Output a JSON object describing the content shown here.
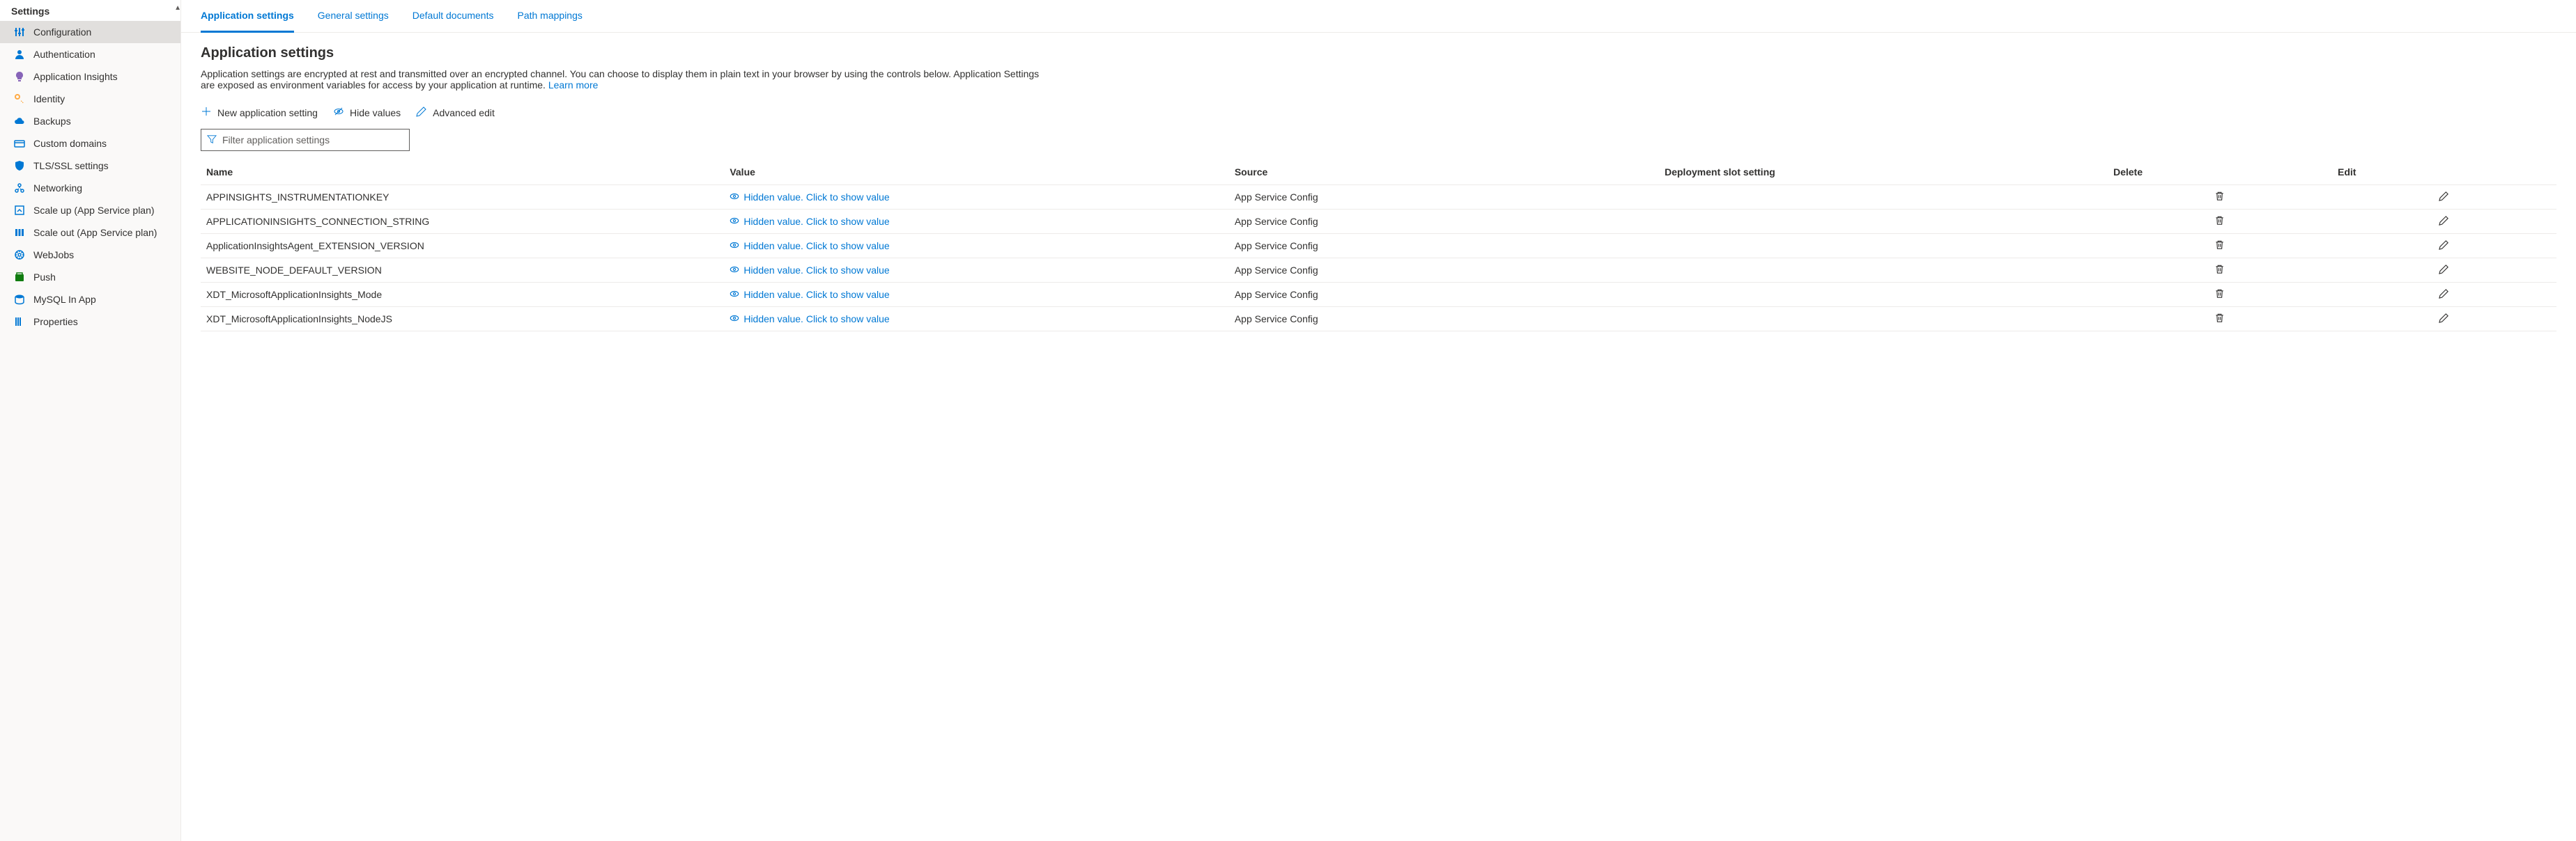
{
  "sidebar": {
    "title": "Settings",
    "items": [
      {
        "icon": "sliders",
        "label": "Configuration",
        "active": true,
        "color": "#0078d4"
      },
      {
        "icon": "user",
        "label": "Authentication",
        "active": false,
        "color": "#0078d4"
      },
      {
        "icon": "bulb",
        "label": "Application Insights",
        "active": false,
        "color": "#8764b8"
      },
      {
        "icon": "key",
        "label": "Identity",
        "active": false,
        "color": "#ffaa44"
      },
      {
        "icon": "cloud",
        "label": "Backups",
        "active": false,
        "color": "#0078d4"
      },
      {
        "icon": "domain",
        "label": "Custom domains",
        "active": false,
        "color": "#0078d4"
      },
      {
        "icon": "shield",
        "label": "TLS/SSL settings",
        "active": false,
        "color": "#0078d4"
      },
      {
        "icon": "network",
        "label": "Networking",
        "active": false,
        "color": "#0078d4"
      },
      {
        "icon": "scaleup",
        "label": "Scale up (App Service plan)",
        "active": false,
        "color": "#0078d4"
      },
      {
        "icon": "scaleout",
        "label": "Scale out (App Service plan)",
        "active": false,
        "color": "#0078d4"
      },
      {
        "icon": "webjobs",
        "label": "WebJobs",
        "active": false,
        "color": "#0078d4"
      },
      {
        "icon": "push",
        "label": "Push",
        "active": false,
        "color": "#107c10"
      },
      {
        "icon": "mysql",
        "label": "MySQL In App",
        "active": false,
        "color": "#0078d4"
      },
      {
        "icon": "properties",
        "label": "Properties",
        "active": false,
        "color": "#0078d4"
      }
    ]
  },
  "tabs": [
    {
      "label": "Application settings",
      "active": true
    },
    {
      "label": "General settings",
      "active": false
    },
    {
      "label": "Default documents",
      "active": false
    },
    {
      "label": "Path mappings",
      "active": false
    }
  ],
  "section": {
    "title": "Application settings",
    "desc_part1": "Application settings are encrypted at rest and transmitted over an encrypted channel. You can choose to display them in plain text in your browser by using the controls below. Application Settings are exposed as environment variables for access by your application at runtime. ",
    "learn_more": "Learn more"
  },
  "toolbar": {
    "new_label": "New application setting",
    "hide_label": "Hide values",
    "advanced_label": "Advanced edit"
  },
  "filter": {
    "placeholder": "Filter application settings"
  },
  "table": {
    "headers": {
      "name": "Name",
      "value": "Value",
      "source": "Source",
      "slot": "Deployment slot setting",
      "delete": "Delete",
      "edit": "Edit"
    },
    "hidden_text": "Hidden value. Click to show value",
    "rows": [
      {
        "name": "APPINSIGHTS_INSTRUMENTATIONKEY",
        "source": "App Service Config"
      },
      {
        "name": "APPLICATIONINSIGHTS_CONNECTION_STRING",
        "source": "App Service Config"
      },
      {
        "name": "ApplicationInsightsAgent_EXTENSION_VERSION",
        "source": "App Service Config"
      },
      {
        "name": "WEBSITE_NODE_DEFAULT_VERSION",
        "source": "App Service Config"
      },
      {
        "name": "XDT_MicrosoftApplicationInsights_Mode",
        "source": "App Service Config"
      },
      {
        "name": "XDT_MicrosoftApplicationInsights_NodeJS",
        "source": "App Service Config"
      }
    ]
  }
}
